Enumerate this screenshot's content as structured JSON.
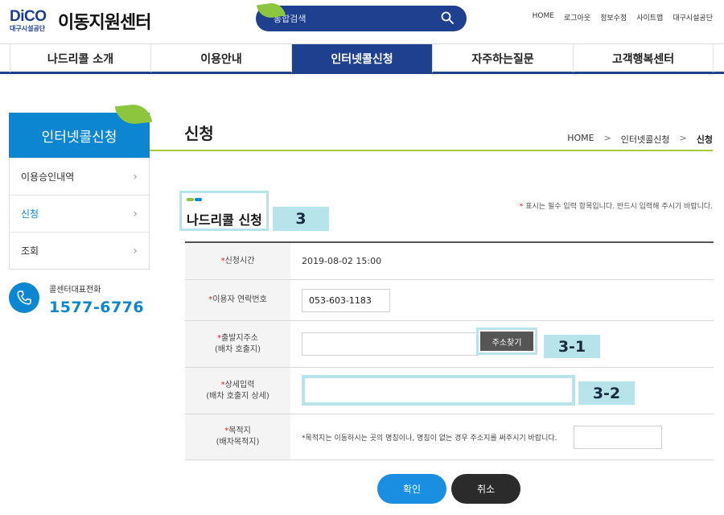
{
  "header": {
    "logo_brand": "DiCO",
    "logo_sub": "대구시설공단",
    "logo_title": "이동지원센터",
    "search_placeholder": "통합검색",
    "util_links": [
      "HOME",
      "로그아웃",
      "정보수정",
      "사이트맵",
      "대구시설공단"
    ]
  },
  "gnb": {
    "items": [
      "나드리콜 소개",
      "이용안내",
      "인터넷콜신청",
      "자주하는질문",
      "고객행복센터"
    ],
    "active_index": 2
  },
  "sidebar": {
    "title": "인터넷콜신청",
    "items": [
      {
        "label": "이용승인내역"
      },
      {
        "label": "신청"
      },
      {
        "label": "조회"
      }
    ],
    "active_index": 1,
    "call_label": "콜센터대표전화",
    "call_number": "1577-6776"
  },
  "content": {
    "page_title": "신청",
    "breadcrumb": [
      "HOME",
      "인터넷콜신청",
      "신청"
    ],
    "section_title": "나드리콜 신청",
    "required_note": "표시는 필수 입력 항목입니다. 반드시 입력해 주시기 바랍니다.",
    "required_star": "*"
  },
  "annotations": {
    "tag_section": "3",
    "tag_address_button": "3-1",
    "tag_detail_input": "3-2"
  },
  "form": {
    "request_time_label": "신청시간",
    "request_time_value": "2019-08-02 15:00",
    "contact_label": "이용자 연락번호",
    "contact_value": "053-603-1183",
    "origin_label_1": "출발지주소",
    "origin_label_2": "(배차 호출지)",
    "address_search_button": "주소찾기",
    "detail_label_1": "상세입력",
    "detail_label_2": "(배차 호출지 상세)",
    "detail_value": "",
    "destination_label_1": "목적지",
    "destination_label_2": "(배차목적지)",
    "destination_note": "*목적지는 이동하시는 곳의 명칭이나, 명칭이 없는 경우 주소지를 써주시기 바랍니다.",
    "destination_value": ""
  },
  "actions": {
    "confirm_label": "확인",
    "cancel_label": "취소"
  },
  "colors": {
    "brand_navy": "#1f3f8f",
    "brand_blue": "#0c86d1",
    "brand_green": "#8cc63f",
    "annotation_cyan": "#b7e4ea",
    "cancel_dark": "#2b2b2b",
    "confirm_blue": "#1a8ee0"
  },
  "icons": {
    "search": "search-icon",
    "phone": "phone-icon",
    "chevron": "chevron-right-icon"
  }
}
